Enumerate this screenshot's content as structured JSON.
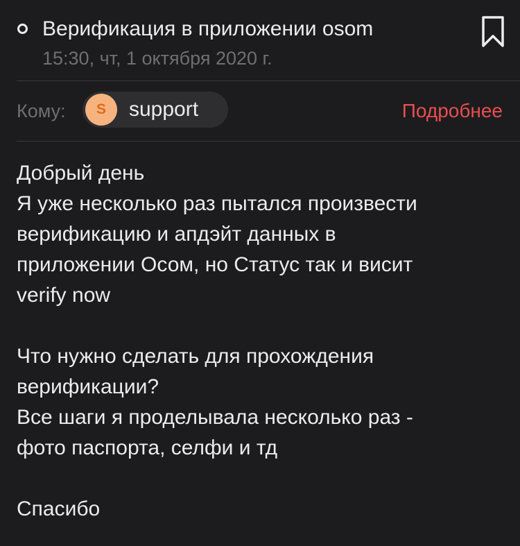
{
  "message": {
    "subject": "Верификация в приложении osom",
    "date": "15:30, чт, 1 октября 2020 г.",
    "to_label": "Кому:",
    "recipient": {
      "initial": "S",
      "name": "support"
    },
    "details_link": "Подробнее",
    "body_lines": [
      "Добрый день",
      "Я уже несколько раз пытался произвести",
      "верификацию и апдэйт данных в",
      "приложении Осом, но Статус так и висит",
      "verify now",
      "",
      "Что нужно сделать для прохождения",
      "верификации?",
      "Все шаги я проделывала несколько раз -",
      "фото паспорта, селфи и тд",
      "",
      "Спасибо"
    ]
  },
  "icons": {
    "unread": "unread-dot-icon",
    "bookmark": "bookmark-icon"
  },
  "colors": {
    "background": "#1c1c1e",
    "text": "#ececec",
    "secondary_text": "#6f6f72",
    "accent_link": "#ea4d50",
    "avatar_bg": "#f7b37f",
    "avatar_text": "#e06a1c",
    "chip_bg": "#2e2e30"
  }
}
